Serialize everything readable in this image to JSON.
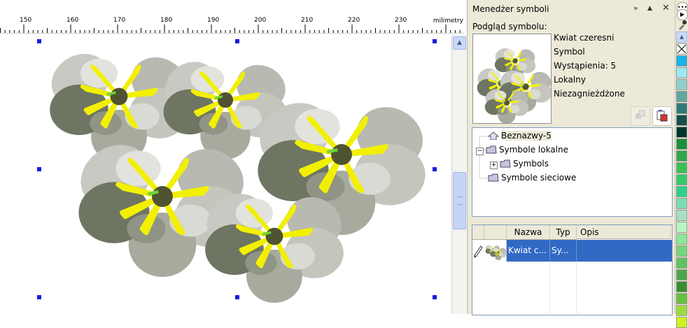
{
  "ruler": {
    "ticks": [
      "150",
      "160",
      "170",
      "180",
      "190",
      "200",
      "210",
      "220",
      "230"
    ],
    "unit": "milimetry"
  },
  "docker": {
    "title": "Menedżer symboli",
    "preview_label": "Podgląd symbolu:",
    "info": {
      "name": "Kwiat czeresni",
      "type": "Symbol",
      "instances": "Wystąpienia: 5",
      "scope": "Lokalny",
      "nesting": "Niezagnieżdżone"
    },
    "tree": [
      {
        "label": "Beznazwy-5"
      },
      {
        "label": "Symbole lokalne"
      },
      {
        "label": "Symbols"
      },
      {
        "label": "Symbole sieciowe"
      }
    ],
    "list": {
      "columns": [
        "Nazwa",
        "Typ",
        "Opis"
      ],
      "rows": [
        {
          "name": "Kwiat c...",
          "type": "Sy...",
          "desc": ""
        }
      ]
    }
  },
  "colors": {
    "selection_row": "#316ac5",
    "handle": "#1a1adf",
    "petal_dark": "#6e7562",
    "petal_light": "#c9c9c3",
    "stamen": "#f2f000",
    "center": "#4f5332"
  },
  "palette": [
    "#ffffff",
    "#17b3e8",
    "#9be7f2",
    "#8fd0cf",
    "#61a6a4",
    "#2f7b79",
    "#15504f",
    "#00352f",
    "#1b8f3b",
    "#2ea74d",
    "#38c05a",
    "#35c96a",
    "#2ed08e",
    "#7bdcb3",
    "#a6e0c4",
    "#b6f5c4",
    "#8de79a",
    "#76d57b",
    "#5fc35f",
    "#4da64b",
    "#3a8c34",
    "#64c33d",
    "#9edc3b",
    "#cdf21d"
  ]
}
